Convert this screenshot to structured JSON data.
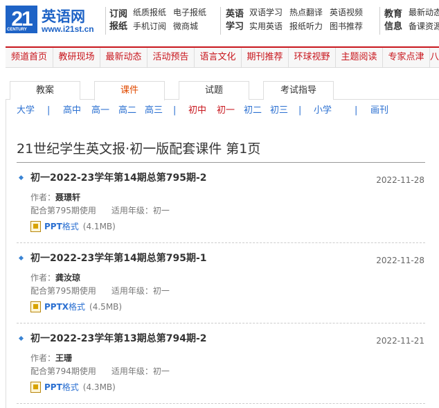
{
  "logo": {
    "number": "21",
    "century": "CENTURY",
    "brand": "英语网",
    "url": "www.i21st.cn"
  },
  "header": {
    "groups": [
      {
        "label": "订阅报纸",
        "links": [
          "纸质报纸",
          "电子报纸",
          "手机订阅",
          "微商城"
        ]
      },
      {
        "label": "英语学习",
        "links": [
          "双语学习",
          "热点翻译",
          "英语视频",
          "实用英语",
          "报纸听力",
          "图书推荐"
        ]
      },
      {
        "label": "教育信息",
        "links": [
          "最新动态",
          "备课资源"
        ]
      }
    ]
  },
  "rednav": [
    "频道首页",
    "教研现场",
    "最新动态",
    "活动预告",
    "语言文化",
    "期刊推荐",
    "环球视野",
    "主题阅读",
    "专家点津",
    "八"
  ],
  "tabs": [
    "教案",
    "课件",
    "试题",
    "考试指导"
  ],
  "active_tab": "课件",
  "filters": {
    "daxue": "大学",
    "sep": "|",
    "gaozhong": "高中",
    "gao1": "高一",
    "gao2": "高二",
    "gao3": "高三",
    "chuzhong": "初中",
    "chu1": "初一",
    "chu2": "初二",
    "chu3": "初三",
    "xiaoxue": "小学",
    "huakan": "画刊"
  },
  "page_title": "21世纪学生英文报·初一版配套课件 第1页",
  "entries": [
    {
      "title": "初一2022-23学年第14期总第795期-2",
      "date": "2022-11-28",
      "author_label": "作者：",
      "author": "聂璟轩",
      "issue": "配合第795期使用",
      "grade_label": "适用年级：初一",
      "format": "PPT",
      "format_suffix": "格式",
      "size": "(4.1MB)"
    },
    {
      "title": "初一2022-23学年第14期总第795期-1",
      "date": "2022-11-28",
      "author_label": "作者：",
      "author": "龚汝琼",
      "issue": "配合第795期使用",
      "grade_label": "适用年级：初一",
      "format": "PPTX",
      "format_suffix": "格式",
      "size": "(4.5MB)"
    },
    {
      "title": "初一2022-23学年第13期总第794期-2",
      "date": "2022-11-21",
      "author_label": "作者：",
      "author": "王珊",
      "issue": "配合第794期使用",
      "grade_label": "适用年级：初一",
      "format": "PPT",
      "format_suffix": "格式",
      "size": "(4.3MB)"
    }
  ]
}
